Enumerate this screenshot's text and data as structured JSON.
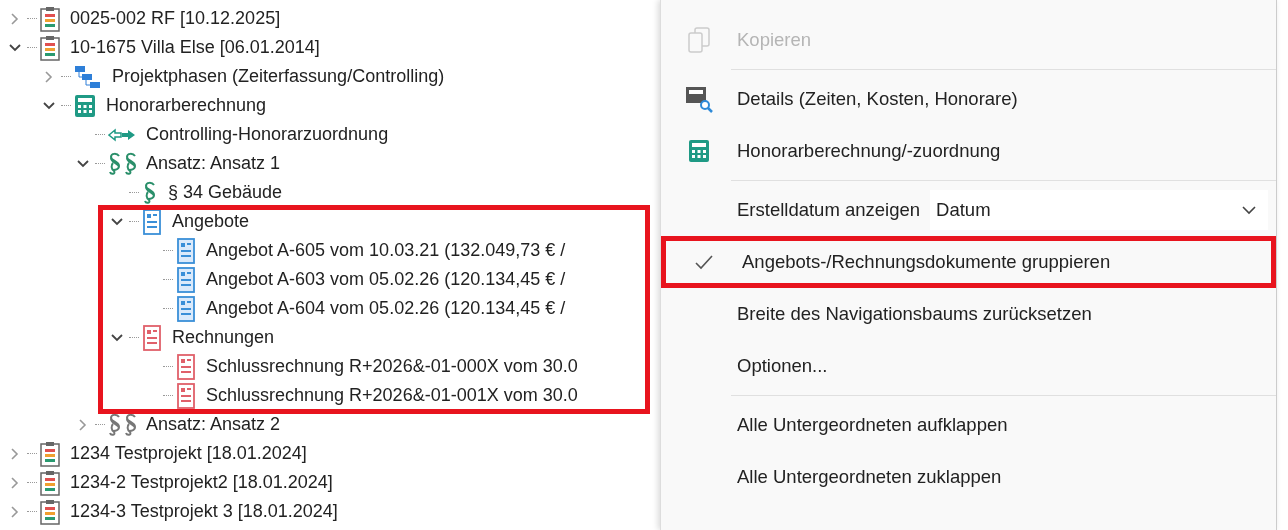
{
  "tree": [
    {
      "kind": "project",
      "label": "0025-002 RF [10.12.2025]",
      "expanded": false
    },
    {
      "kind": "project",
      "label": "10-1675 Villa Else [06.01.2014]",
      "expanded": true,
      "children": [
        {
          "kind": "phases",
          "label": "Projektphasen (Zeiterfassung/Controlling)",
          "expanded": false
        },
        {
          "kind": "calculator",
          "label": "Honorarberechnung",
          "expanded": true,
          "children": [
            {
              "kind": "assignment",
              "label": "Controlling-Honorarzuordnung"
            },
            {
              "kind": "approach",
              "label": "Ansatz: Ansatz 1",
              "expanded": true,
              "children": [
                {
                  "kind": "section",
                  "label": "§ 34 Gebäude"
                },
                {
                  "kind": "offer-group",
                  "label": "Angebote",
                  "expanded": true,
                  "children": [
                    {
                      "kind": "offer",
                      "label": "Angebot A-605 vom 10.03.21 (132.049,73 € /"
                    },
                    {
                      "kind": "offer",
                      "label": "Angebot A-603 vom 05.02.26 (120.134,45 € /"
                    },
                    {
                      "kind": "offer",
                      "label": "Angebot A-604 vom 05.02.26 (120.134,45 € /"
                    }
                  ]
                },
                {
                  "kind": "invoice-group",
                  "label": "Rechnungen",
                  "expanded": true,
                  "children": [
                    {
                      "kind": "invoice",
                      "label": "Schlussrechnung R+2026&-01-000X vom 30.0"
                    },
                    {
                      "kind": "invoice",
                      "label": "Schlussrechnung R+2026&-01-001X vom 30.0"
                    }
                  ]
                }
              ]
            },
            {
              "kind": "approach-inactive",
              "label": "Ansatz: Ansatz 2",
              "expanded": false
            }
          ]
        }
      ]
    },
    {
      "kind": "project",
      "label": "1234 Testprojekt [18.01.2024]",
      "expanded": false
    },
    {
      "kind": "project",
      "label": "1234-2 Testprojekt2 [18.01.2024]",
      "expanded": false
    },
    {
      "kind": "project",
      "label": "1234-3 Testprojekt 3 [18.01.2024]",
      "expanded": false
    }
  ],
  "menu": [
    {
      "kind": "copy",
      "label": "Kopieren",
      "disabled": true
    },
    {
      "kind": "separator"
    },
    {
      "kind": "details",
      "label": "Details (Zeiten, Kosten, Honorare)",
      "disabled": false
    },
    {
      "kind": "calculator",
      "label": "Honorarberechnung/-zuordnung",
      "disabled": false
    },
    {
      "kind": "separator"
    },
    {
      "kind": "dropdown",
      "label": "Erstelldatum anzeigen",
      "value": "Datum"
    },
    {
      "kind": "toggle",
      "label": "Angebots-/Rechnungsdokumente gruppieren",
      "checked": true
    },
    {
      "kind": "plain",
      "label": "Breite des Navigationsbaums zurücksetzen",
      "disabled": false
    },
    {
      "kind": "plain",
      "label": "Optionen...",
      "disabled": false
    },
    {
      "kind": "separator"
    },
    {
      "kind": "plain",
      "label": "Alle Untergeordneten aufklappen",
      "disabled": false
    },
    {
      "kind": "plain",
      "label": "Alle Untergeordneten zuklappen",
      "disabled": false
    }
  ]
}
